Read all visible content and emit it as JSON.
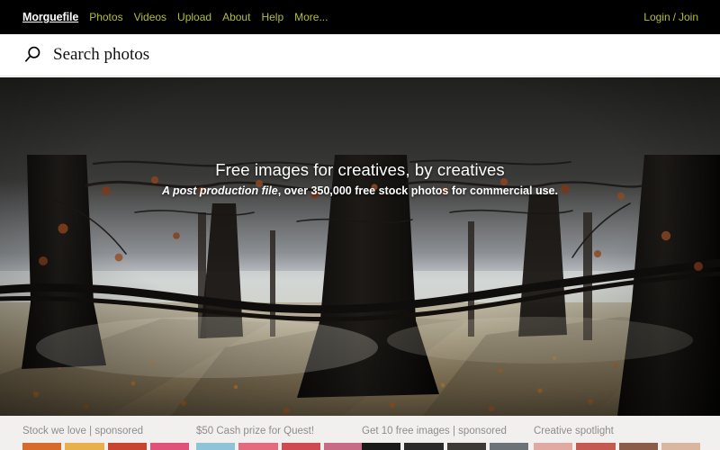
{
  "site": {
    "brand": "Morguefile",
    "accent_color": "#b5bd3a",
    "header_bg": "#000000",
    "promo_bg": "#f1f0ef"
  },
  "topnav": {
    "links": [
      {
        "label": "Photos",
        "name": "nav-photos"
      },
      {
        "label": "Videos",
        "name": "nav-videos"
      },
      {
        "label": "Upload",
        "name": "nav-upload"
      },
      {
        "label": "About",
        "name": "nav-about"
      },
      {
        "label": "Help",
        "name": "nav-help"
      },
      {
        "label": "More...",
        "name": "nav-more"
      }
    ],
    "account": {
      "login_label": "Login",
      "separator": "/",
      "join_label": "Join"
    }
  },
  "search": {
    "icon": "search-icon",
    "value": "",
    "placeholder": "Search photos"
  },
  "hero": {
    "title": "Free images for creatives, by creatives",
    "subtitle_italic": "A post production file",
    "subtitle_rest": ", over 350,000 free stock photos for commercial use.",
    "image_alt": "Sunlit winter forest with bare trees and fallen autumn leaves"
  },
  "promos": [
    {
      "label": "Stock we love | sponsored",
      "thumbs": [
        "#d86a2a",
        "#e8b04a",
        "#c9442f",
        "#e0527a"
      ]
    },
    {
      "label": "$50 Cash prize for Quest!",
      "thumbs": [
        "#8fc3d8",
        "#e46a7e",
        "#d04a52",
        "#c76a86"
      ]
    },
    {
      "label": "Get 10 free images | sponsored",
      "thumbs": [
        "#1a1a1a",
        "#2a2a2a",
        "#3d3a35",
        "#6b7278"
      ]
    },
    {
      "label": "Creative spotlight",
      "thumbs": [
        "#e0a9a2",
        "#c45a52",
        "#8c5c4a",
        "#d8b6a0"
      ]
    }
  ]
}
